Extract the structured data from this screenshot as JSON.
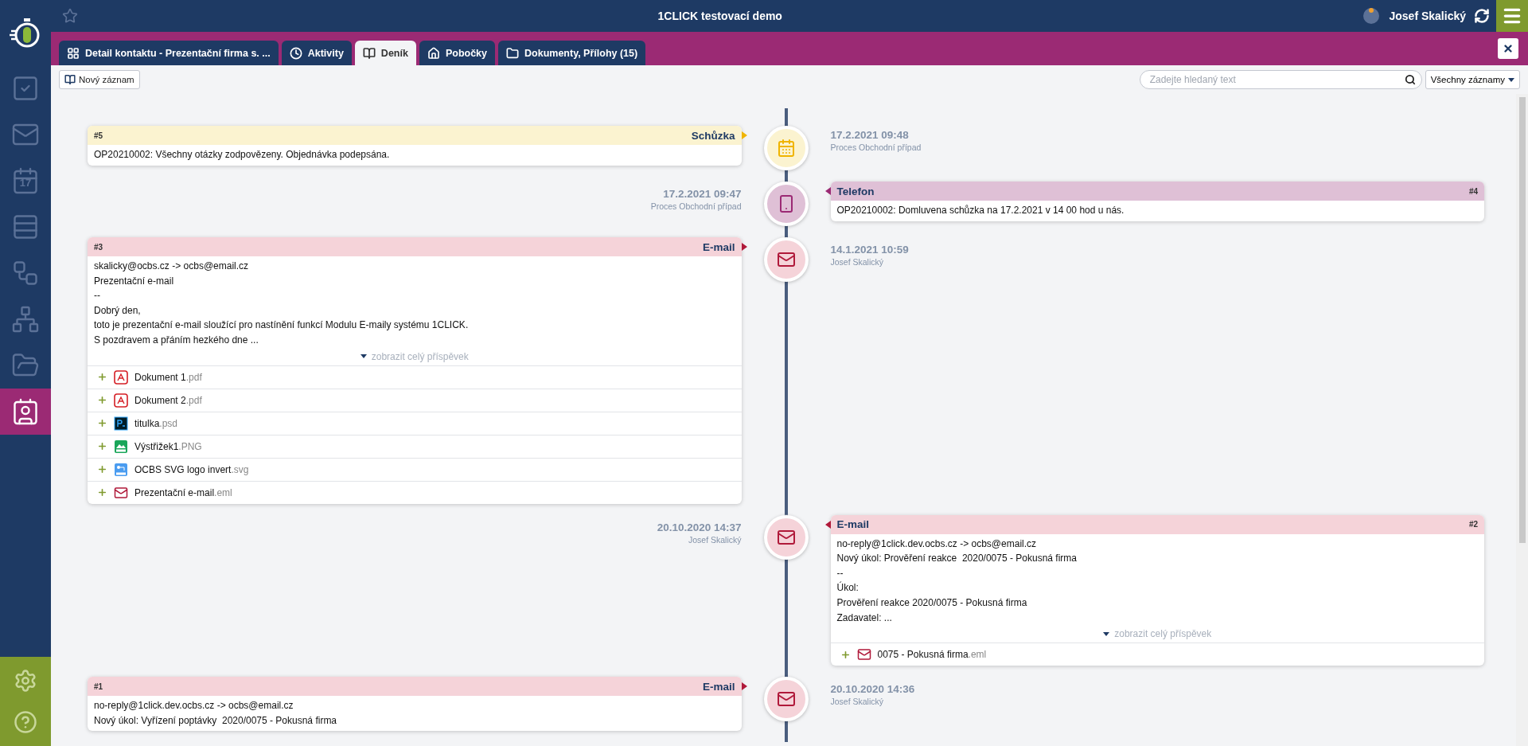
{
  "app": {
    "title": "1CLICK testovací demo",
    "user": "Josef Skalický"
  },
  "sidebar": {
    "items": [
      {
        "kind": "tasks",
        "selected": false
      },
      {
        "kind": "mail",
        "selected": false
      },
      {
        "kind": "calendar",
        "day": "17",
        "selected": false
      },
      {
        "kind": "list",
        "selected": false
      },
      {
        "kind": "flow",
        "selected": false
      },
      {
        "kind": "org",
        "selected": false
      },
      {
        "kind": "folder",
        "selected": false
      },
      {
        "kind": "contacts",
        "selected": true
      }
    ],
    "bottom": [
      {
        "kind": "settings"
      },
      {
        "kind": "help"
      }
    ]
  },
  "tabs": [
    {
      "label": "Detail kontaktu - Prezentační firma s. ...",
      "selected": false
    },
    {
      "label": "Aktivity",
      "selected": false
    },
    {
      "label": "Deník",
      "selected": true
    },
    {
      "label": "Pobočky",
      "selected": false
    },
    {
      "label": "Dokumenty, Přílohy (15)",
      "selected": false
    }
  ],
  "toolbar": {
    "new_button": "Nový záznam",
    "search": {
      "placeholder": "Zadejte hledaný text"
    },
    "filter": "Všechny záznamy"
  },
  "timeline": [
    {
      "kind": "meeting",
      "number": "#5",
      "type": "Schůzka",
      "date": "17.2.2021 09:48",
      "subtitle": "Proces Obchodní případ",
      "body": [
        "OP20210002: Všechny otázky zodpovězeny. Objednávka podepsána."
      ]
    },
    {
      "kind": "phone",
      "number": "#4",
      "type": "Telefon",
      "date": "17.2.2021 09:47",
      "subtitle": "Proces Obchodní případ",
      "body": [
        "OP20210002: Domluvena schůzka na 17.2.2021 v 14 00 hod u nás."
      ]
    },
    {
      "kind": "email",
      "number": "#3",
      "type": "E-mail",
      "date": "14.1.2021 10:59",
      "subtitle": "Josef Skalický",
      "body": [
        "skalicky@ocbs.cz -> ocbs@email.cz",
        "Prezentační e-mail",
        "--",
        "Dobrý den,",
        "toto je prezentační e-mail sloužící pro nastínění funkcí Modulu E-maily systému 1CLICK.",
        "S pozdravem a přáním hezkého dne ..."
      ],
      "more": "zobrazit celý příspěvek",
      "attachments": [
        {
          "name": "Dokument 1",
          "ext": ".pdf",
          "kind": "pdf"
        },
        {
          "name": "Dokument 2",
          "ext": ".pdf",
          "kind": "pdf"
        },
        {
          "name": "titulka",
          "ext": ".psd",
          "kind": "psd"
        },
        {
          "name": "Výstřižek1",
          "ext": ".PNG",
          "kind": "png"
        },
        {
          "name": "OCBS SVG logo invert",
          "ext": ".svg",
          "kind": "svg"
        },
        {
          "name": "Prezentační e-mail",
          "ext": ".eml",
          "kind": "eml"
        }
      ]
    },
    {
      "kind": "email",
      "number": "#2",
      "type": "E-mail",
      "date": "20.10.2020 14:37",
      "subtitle": "Josef Skalický",
      "body": [
        "no-reply@1click.dev.ocbs.cz -> ocbs@email.cz",
        "Nový úkol: Prověření reakce  2020/0075 - Pokusná firma",
        "--",
        "Úkol:",
        "Prověření reakce 2020/0075 - Pokusná firma",
        "Zadavatel: ..."
      ],
      "more": "zobrazit celý příspěvek",
      "attachments": [
        {
          "name": "0075 - Pokusná firma",
          "ext": ".eml",
          "kind": "eml"
        }
      ]
    },
    {
      "kind": "email",
      "number": "#1",
      "type": "E-mail",
      "date": "20.10.2020 14:36",
      "subtitle": "Josef Skalický",
      "body": [
        "no-reply@1click.dev.ocbs.cz -> ocbs@email.cz",
        "Nový úkol: Vyřízení poptávky  2020/0075 - Pokusná firma"
      ]
    }
  ]
}
